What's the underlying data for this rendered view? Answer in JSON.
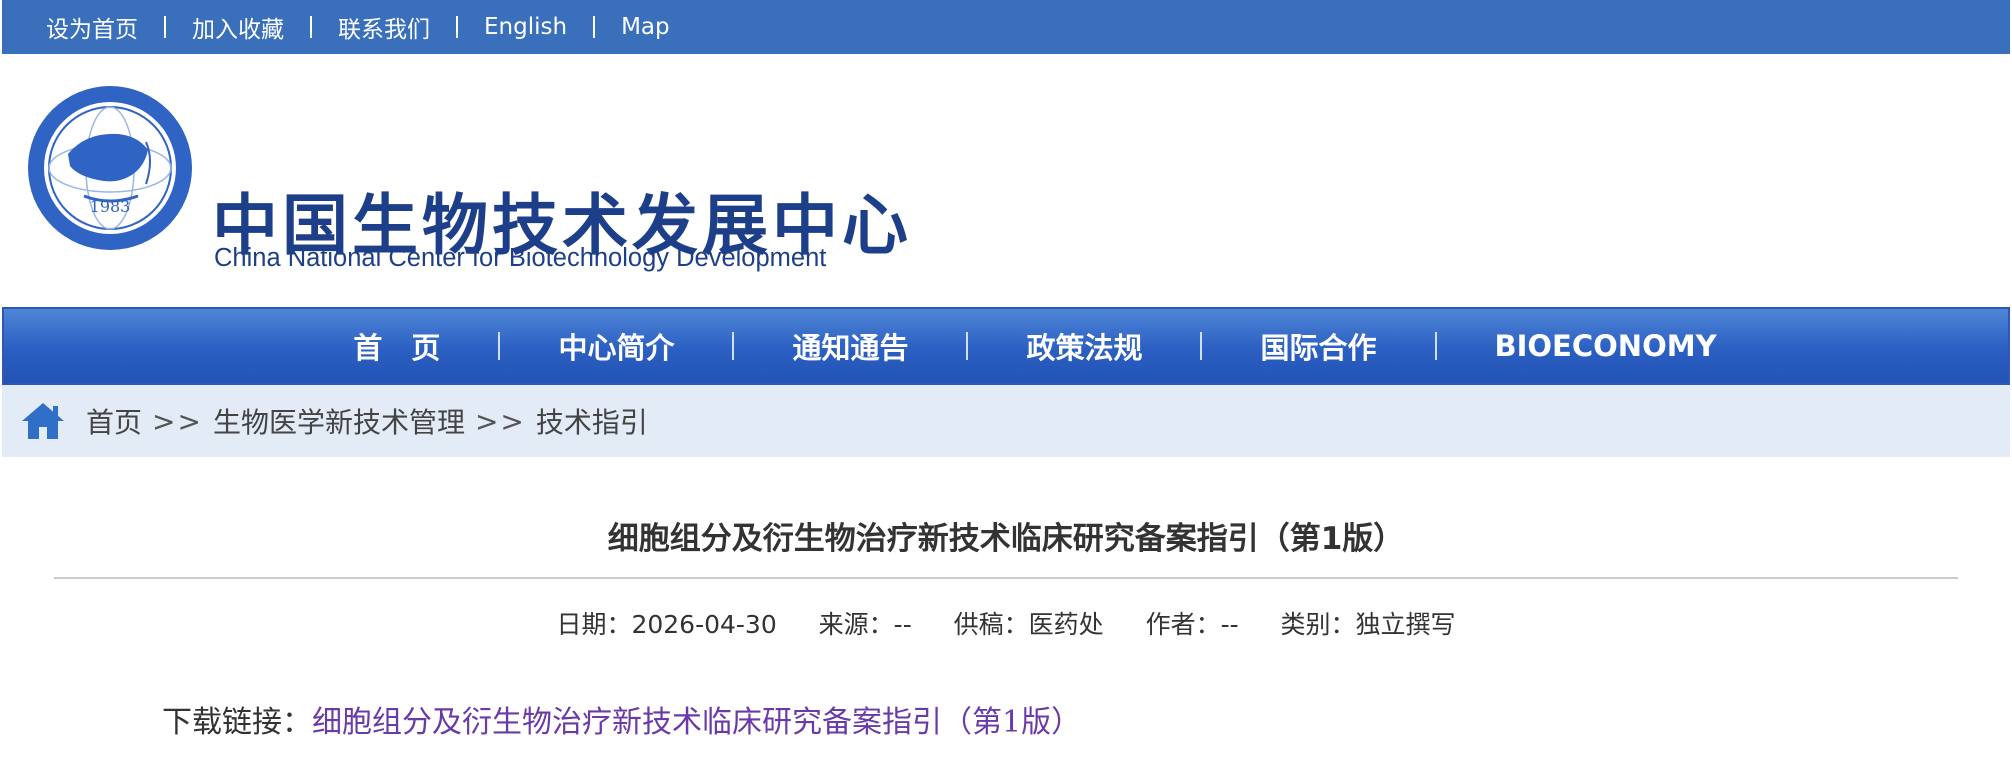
{
  "topbar": {
    "links": [
      "设为首页",
      "加入收藏",
      "联系我们",
      "English",
      "Map"
    ]
  },
  "header": {
    "org_name_cn": "中国生物技术发展中心",
    "org_name_en": "China National Center for Biotechnology Development",
    "seal_year": "1983"
  },
  "nav": {
    "items": [
      "首　页",
      "中心简介",
      "通知通告",
      "政策法规",
      "国际合作",
      "BIOECONOMY"
    ]
  },
  "breadcrumb": {
    "home": "首页",
    "sep": ">>",
    "section": "生物医学新技术管理",
    "page": "技术指引"
  },
  "article": {
    "title": "细胞组分及衍生物治疗新技术临床研究备案指引（第1版）",
    "meta": {
      "date_label": "日期：",
      "date": "2026-04-30",
      "source_label": "来源：",
      "source": "--",
      "provider_label": "供稿：",
      "provider": "医药处",
      "author_label": "作者：",
      "author": "--",
      "category_label": "类别：",
      "category": "独立撰写"
    },
    "download_label": "下载链接：",
    "download_link": "细胞组分及衍生物治疗新技术临床研究备案指引（第1版）"
  },
  "colors": {
    "topbar": "#3a70bb",
    "nav": "#2b5fc2",
    "breadcrumb_bg": "#e3ebf7",
    "link": "#6a3aa8",
    "brand_text": "#1d3f8a"
  }
}
